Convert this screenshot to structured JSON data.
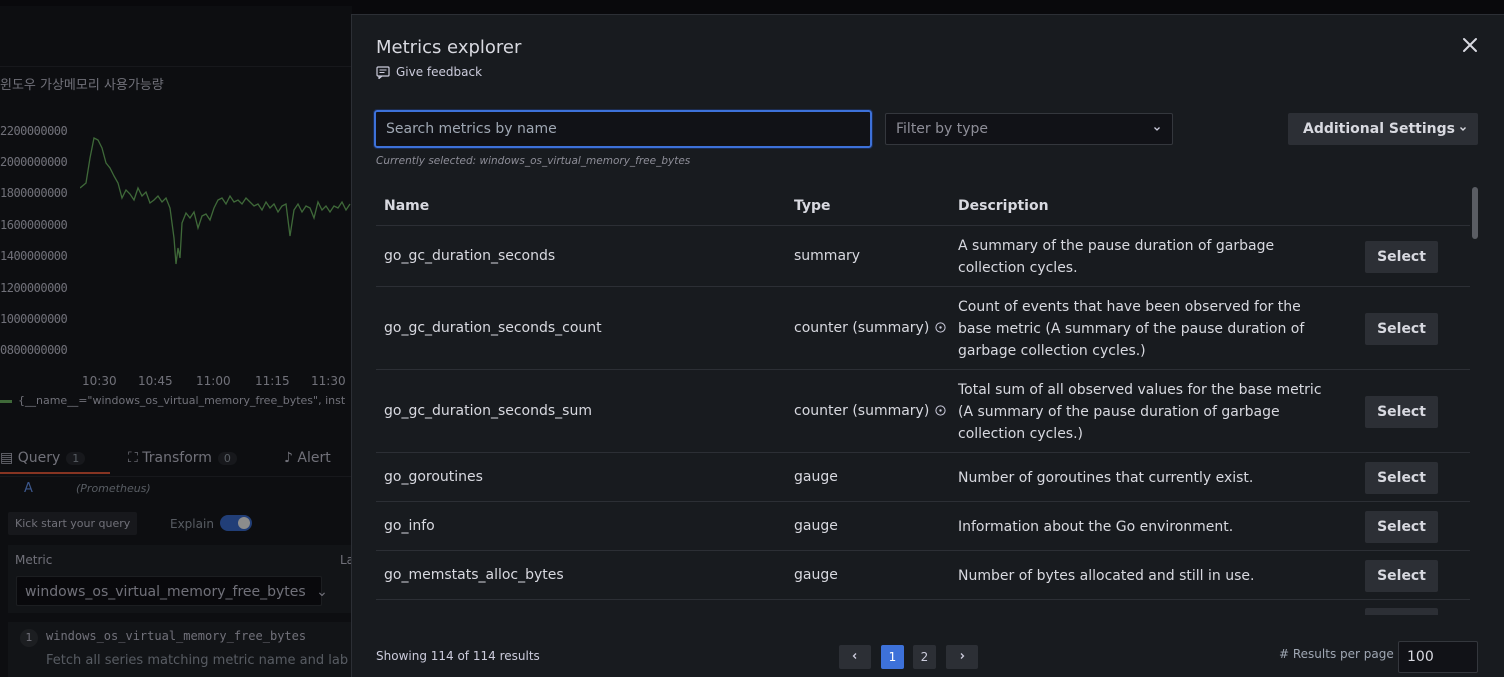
{
  "background": {
    "panel_title": "윈도우 가상메모리 사용가능량",
    "y_ticks": [
      "2200000000",
      "2000000000",
      "1800000000",
      "1600000000",
      "1400000000",
      "1200000000",
      "1000000000",
      "0800000000"
    ],
    "x_ticks": [
      "10:30",
      "10:45",
      "11:00",
      "11:15",
      "11:30"
    ],
    "legend": "{__name__=\"windows_os_virtual_memory_free_bytes\", inst",
    "tabs": [
      {
        "label": "Query",
        "count": "1"
      },
      {
        "label": "Transform",
        "count": "0"
      },
      {
        "label": "Alert",
        "count": ""
      }
    ],
    "query_letter": "A",
    "query_datasource": "(Prometheus)",
    "kick_start": "Kick start your query",
    "explain": "Explain",
    "metric_label": "Metric",
    "labels_label": "La",
    "metric_value": "windows_os_virtual_memory_free_bytes",
    "hint_num": "1",
    "hint_code": "windows_os_virtual_memory_free_bytes",
    "hint_text": "Fetch all series matching metric name and lab",
    "series_color": "#73bf69"
  },
  "explorer": {
    "title": "Metrics explorer",
    "feedback": "Give feedback",
    "search_placeholder": "Search metrics by name",
    "filter_placeholder": "Filter by type",
    "additional_settings": "Additional Settings",
    "currently_selected": "Currently selected: windows_os_virtual_memory_free_bytes",
    "columns": [
      "Name",
      "Type",
      "Description"
    ],
    "select_label": "Select",
    "rows": [
      {
        "name": "go_gc_duration_seconds",
        "type": "summary",
        "description": "A summary of the pause duration of garbage collection cycles."
      },
      {
        "name": "go_gc_duration_seconds_count",
        "type": "counter (summary)",
        "description": "Count of events that have been observed for the base metric (A summary of the pause duration of garbage collection cycles.)"
      },
      {
        "name": "go_gc_duration_seconds_sum",
        "type": "counter (summary)",
        "description": "Total sum of all observed values for the base metric (A summary of the pause duration of garbage collection cycles.)"
      },
      {
        "name": "go_goroutines",
        "type": "gauge",
        "description": "Number of goroutines that currently exist."
      },
      {
        "name": "go_info",
        "type": "gauge",
        "description": "Information about the Go environment."
      },
      {
        "name": "go_memstats_alloc_bytes",
        "type": "gauge",
        "description": "Number of bytes allocated and still in use."
      }
    ],
    "showing": "Showing 114 of 114 results",
    "pages": [
      "1",
      "2"
    ],
    "current_page": "1",
    "results_per_page_label": "# Results per page",
    "results_per_page": "100",
    "accent_color": "#3d71d9"
  }
}
